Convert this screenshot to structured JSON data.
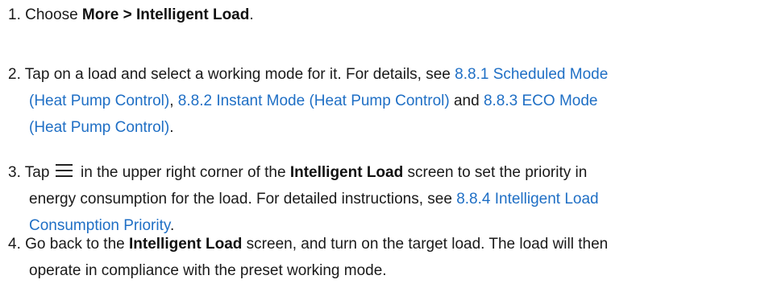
{
  "steps": [
    {
      "number": "1.",
      "pre": "Choose ",
      "bold": "More > Intelligent Load",
      "post": "."
    },
    {
      "number": "2.",
      "text1": "Tap on a load and select a working mode for it. For details, see ",
      "link1a": "8.8.1 Scheduled Mode",
      "link1b": "(Heat Pump Control)",
      "sep1": ", ",
      "link2": "8.8.2 Instant Mode (Heat Pump Control)",
      "sep2": " and ",
      "link3a": "8.8.3 ECO Mode",
      "link3b": "(Heat Pump Control)",
      "end": "."
    },
    {
      "number": "3.",
      "pre": "Tap",
      "icon": "menu-icon",
      "mid": "in the upper right corner of the ",
      "bold": "Intelligent Load",
      "post": " screen to set the priority in",
      "line2": "energy consumption for the load. For detailed instructions, see ",
      "link_a": "8.8.4 Intelligent Load",
      "link_b": "Consumption Priority",
      "end": "."
    },
    {
      "number": "4.",
      "pre": "Go back to the ",
      "bold": "Intelligent Load",
      "post": " screen, and turn on the target load. The load will then",
      "line2": "operate in compliance with the preset working mode."
    }
  ],
  "colors": {
    "text": "#1a1a1a",
    "link": "#1f6fc5",
    "background": "#ffffff"
  }
}
